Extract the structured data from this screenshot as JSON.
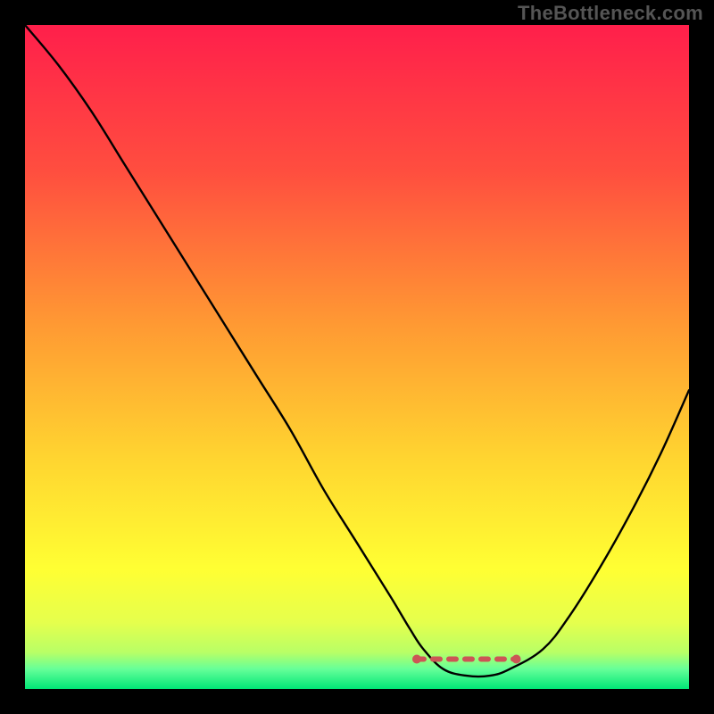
{
  "watermark": "TheBottleneck.com",
  "chart_data": {
    "type": "line",
    "title": "",
    "xlabel": "",
    "ylabel": "",
    "xlim": [
      0,
      100
    ],
    "ylim": [
      0,
      100
    ],
    "legend": false,
    "grid": false,
    "background": {
      "kind": "vertical-gradient",
      "stops": [
        {
          "pos": 0.0,
          "color": "#ff1f4b"
        },
        {
          "pos": 0.22,
          "color": "#ff4e3f"
        },
        {
          "pos": 0.45,
          "color": "#ff9933"
        },
        {
          "pos": 0.65,
          "color": "#ffd430"
        },
        {
          "pos": 0.82,
          "color": "#ffff33"
        },
        {
          "pos": 0.9,
          "color": "#e5ff4d"
        },
        {
          "pos": 0.945,
          "color": "#b8ff66"
        },
        {
          "pos": 0.97,
          "color": "#66ff99"
        },
        {
          "pos": 1.0,
          "color": "#00e676"
        }
      ]
    },
    "series": [
      {
        "name": "bottleneck-curve",
        "color": "#000000",
        "x": [
          0,
          5,
          10,
          15,
          20,
          25,
          30,
          35,
          40,
          45,
          50,
          55,
          58,
          60,
          63,
          66.5,
          70,
          73,
          78,
          82,
          87,
          92,
          96,
          100
        ],
        "y": [
          100,
          94,
          87,
          79,
          71,
          63,
          55,
          47,
          39,
          30,
          22,
          14,
          9,
          6,
          3,
          2,
          2,
          3,
          6,
          11,
          19,
          28,
          36,
          45
        ]
      }
    ],
    "markers": [
      {
        "name": "optimal-range",
        "type": "dashed-segment",
        "color": "#cc5555",
        "x": [
          59,
          74
        ],
        "y": [
          4.5,
          4.5
        ],
        "endpoints": true
      }
    ]
  }
}
